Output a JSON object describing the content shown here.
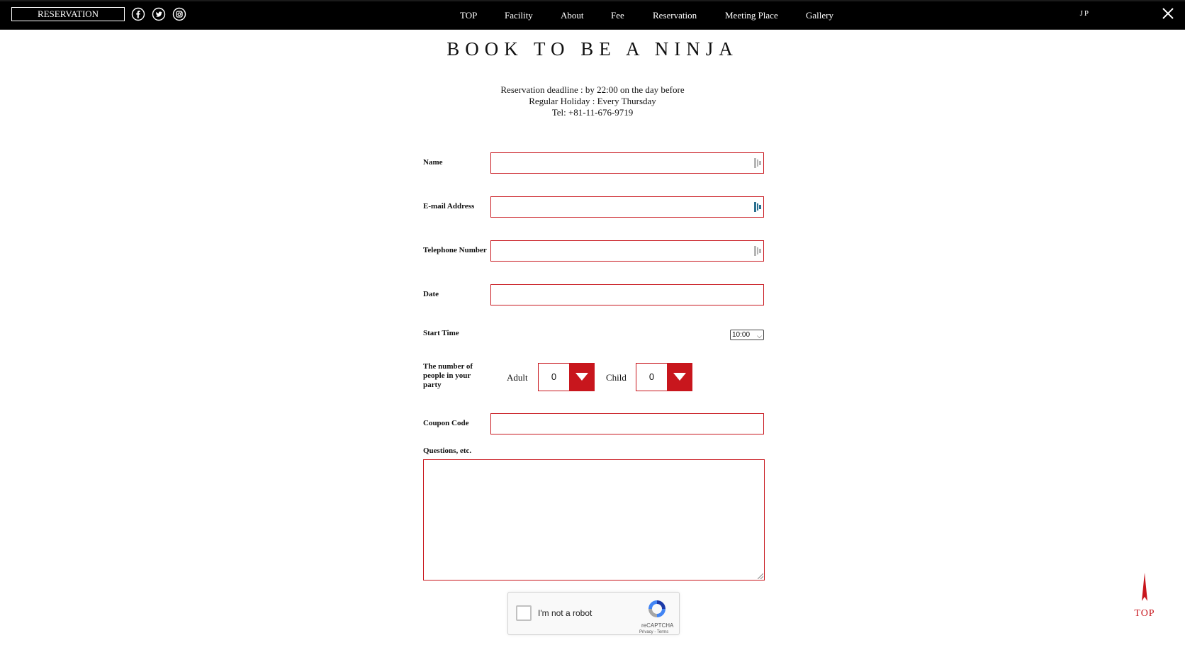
{
  "header": {
    "reservation_button": "RESERVATION",
    "social_icons": [
      "facebook-icon",
      "twitter-icon",
      "instagram-icon"
    ],
    "nav": [
      "TOP",
      "Facility",
      "About",
      "Fee",
      "Reservation",
      "Meeting Place",
      "Gallery"
    ],
    "language": "JP",
    "close_icon": "close-icon"
  },
  "page": {
    "title": "BOOK TO BE A NINJA",
    "notice": [
      "Reservation deadline : by 22:00 on the day before",
      "Regular Holiday : Every Thursday",
      "Tel: +81-11-676-9719"
    ]
  },
  "form": {
    "name_label": "Name",
    "name_value": "",
    "email_label": "E-mail Address",
    "email_value": "",
    "phone_label": "Telephone Number",
    "phone_value": "",
    "date_label": "Date",
    "date_value": "",
    "start_time_label": "Start Time",
    "start_time_value": "10:00",
    "party_label": "The number of people in your party",
    "adult_label": "Adult",
    "adult_value": "0",
    "child_label": "Child",
    "child_value": "0",
    "coupon_label": "Coupon Code",
    "coupon_value": "",
    "questions_label": "Questions, etc.",
    "questions_value": ""
  },
  "captcha": {
    "checkbox_label": "I'm not a robot",
    "brand": "reCAPTCHA",
    "links": "Privacy - Terms"
  },
  "back_to_top": "TOP",
  "colors": {
    "accent": "#c8161d",
    "header_bg": "#000000",
    "header_text": "#ffffff"
  }
}
